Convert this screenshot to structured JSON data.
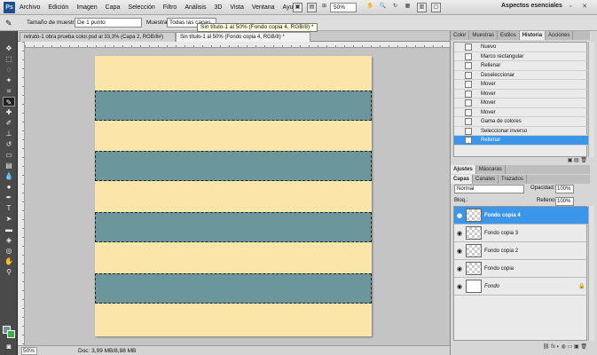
{
  "app": {
    "logo": "Ps"
  },
  "menu": [
    "Archivo",
    "Edición",
    "Imagen",
    "Capa",
    "Selección",
    "Filtro",
    "Análisis",
    "3D",
    "Vista",
    "Ventana",
    "Ayuda"
  ],
  "zoom": "50%",
  "workspace": "Aspectos esenciales",
  "window_buttons": "–  ▫  ✕",
  "options": {
    "sample_size_label": "Tamaño de muestra:",
    "sample_size_value": "De 1 punto",
    "sample_label": "Muestra:",
    "sample_value": "Todas las capas"
  },
  "tabs": [
    "retrato-1 obra prueba  color.psd al 33,3% (Capa 2, RGB/8#)",
    "Sin título-1 al 50% (Fondo copia 4, RGB/8) *"
  ],
  "tooltip": "Sin título-1 al 50% (Fondo copia 4, RGB/8) *",
  "canvas": {
    "base_color": "#fce5a8",
    "stripe_color": "#6b969b",
    "stripe_count": 4
  },
  "status": {
    "zoom": "50%",
    "doc": "Doc: 3,99 MB/8,88 MB"
  },
  "panels": {
    "top_tabs": [
      "Color",
      "Muestras",
      "Estilos",
      "Historia",
      "Acciones"
    ],
    "history_items": [
      "Nuevo",
      "Marco rectangular",
      "Rellenar",
      "Deseleccionar",
      "Mover",
      "Mover",
      "Mover",
      "Mover",
      "Gama de colores",
      "Seleccionar inverso",
      "Rellenar"
    ],
    "history_active_index": 10,
    "mid_tabs": [
      "Ajustes",
      "Máscaras"
    ],
    "layer_tabs": [
      "Capas",
      "Canales",
      "Trazados"
    ],
    "blend_mode": "Normal",
    "opacity_label": "Opacidad:",
    "opacity_value": "100%",
    "lock_label": "Bloq.:",
    "fill_label": "Relleno:",
    "fill_value": "100%",
    "layers": [
      {
        "name": "Fondo copia 4",
        "active": true
      },
      {
        "name": "Fondo copia 3",
        "active": false
      },
      {
        "name": "Fondo copia 2",
        "active": false
      },
      {
        "name": "Fondo copia",
        "active": false
      },
      {
        "name": "Fondo",
        "active": false,
        "locked": true
      }
    ]
  },
  "colors": {
    "foreground": "#6c969a",
    "background": "#3fae49",
    "selection": "#3b95e8"
  }
}
